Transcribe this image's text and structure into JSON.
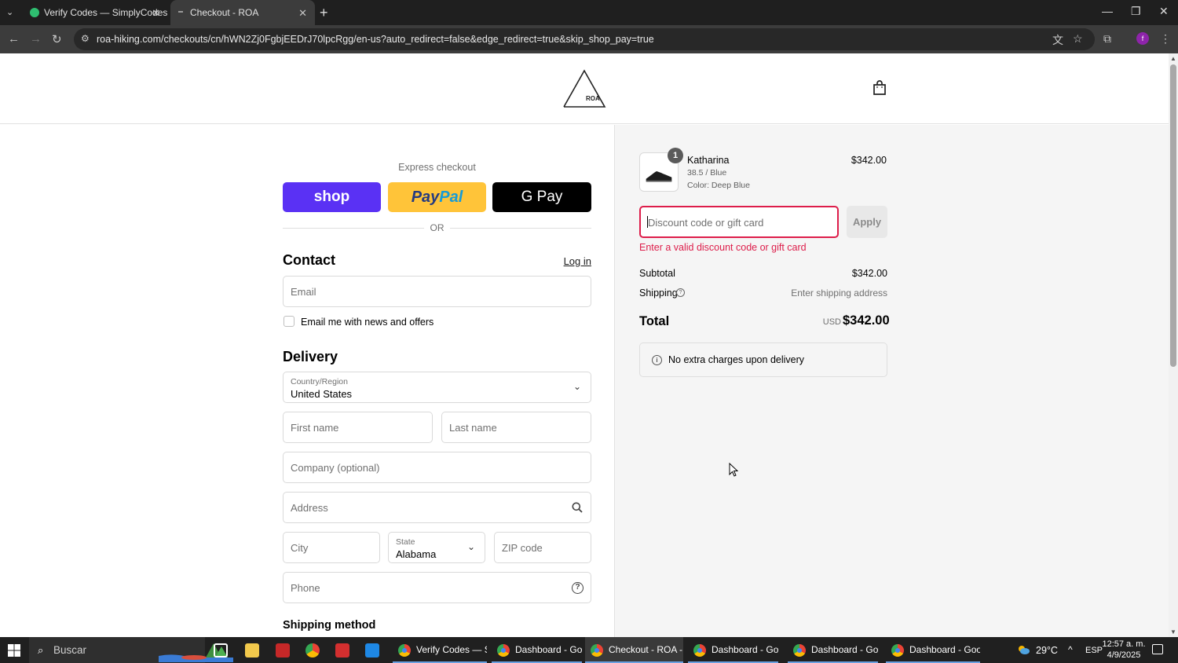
{
  "browser": {
    "tabs": [
      {
        "title": "Verify Codes — SimplyCodes",
        "active": false
      },
      {
        "title": "Checkout - ROA",
        "active": true
      }
    ],
    "url": "roa-hiking.com/checkouts/cn/hWN2Zj0FgbjEEDrJ70lpcRgg/en-us?auto_redirect=false&edge_redirect=true&skip_shop_pay=true",
    "profile_initial": "f"
  },
  "store": {
    "logo_text": "ROA"
  },
  "express": {
    "label": "Express checkout",
    "shop_label": "shop",
    "paypal_pay": "Pay",
    "paypal_pal": "Pal",
    "gpay_label": "G Pay",
    "or_text": "OR"
  },
  "contact": {
    "title": "Contact",
    "login_label": "Log in",
    "email_placeholder": "Email",
    "newsletter_label": "Email me with news and offers"
  },
  "delivery": {
    "title": "Delivery",
    "country_label": "Country/Region",
    "country_value": "United States",
    "first_name_placeholder": "First name",
    "last_name_placeholder": "Last name",
    "company_placeholder": "Company (optional)",
    "address_placeholder": "Address",
    "city_placeholder": "City",
    "state_label": "State",
    "state_value": "Alabama",
    "zip_placeholder": "ZIP code",
    "phone_placeholder": "Phone"
  },
  "shipping_method": {
    "title": "Shipping method"
  },
  "order": {
    "product": {
      "name": "Katharina",
      "variant": "38.5 / Blue",
      "color": "Color: Deep Blue",
      "price": "$342.00",
      "quantity": "1"
    },
    "discount_placeholder": "Discount code or gift card",
    "apply_label": "Apply",
    "discount_error": "Enter a valid discount code or gift card",
    "subtotal_label": "Subtotal",
    "subtotal_value": "$342.00",
    "shipping_label": "Shipping",
    "shipping_value": "Enter shipping address",
    "total_label": "Total",
    "total_currency": "USD",
    "total_value": "$342.00",
    "notice": "No extra charges upon delivery"
  },
  "taskbar": {
    "search_placeholder": "Buscar",
    "apps": [
      {
        "label": "Verify Codes — Sim..."
      },
      {
        "label": "Dashboard - Googl..."
      },
      {
        "label": "Checkout - ROA - ..."
      },
      {
        "label": "Dashboard - Googl..."
      },
      {
        "label": "Dashboard - Googl..."
      },
      {
        "label": "Dashboard - Googl..."
      }
    ],
    "temperature": "29°C",
    "language": "ESP",
    "time": "12:57 a. m.",
    "date": "4/9/2025"
  },
  "colors": {
    "shop_pay": "#5a31f4",
    "paypal": "#ffc439",
    "error": "#dd1d4a",
    "sidebar_bg": "#f5f5f5"
  }
}
